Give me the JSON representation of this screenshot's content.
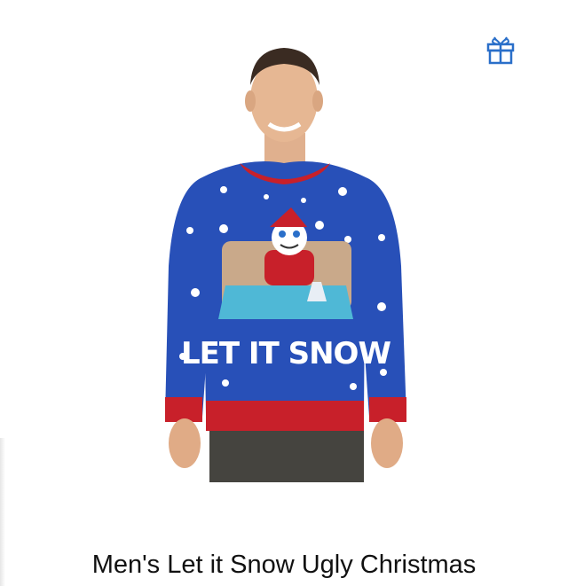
{
  "product": {
    "title": "Men's Let it Snow Ugly Christmas",
    "sweater_text": "LET IT SNOW"
  },
  "icons": {
    "gift": "gift-icon"
  },
  "colors": {
    "accent": "#2a6fc9",
    "sweater_blue": "#2850b8",
    "trim_red": "#c8202a",
    "table_teal": "#4fb8d6",
    "background": "#ffffff"
  }
}
